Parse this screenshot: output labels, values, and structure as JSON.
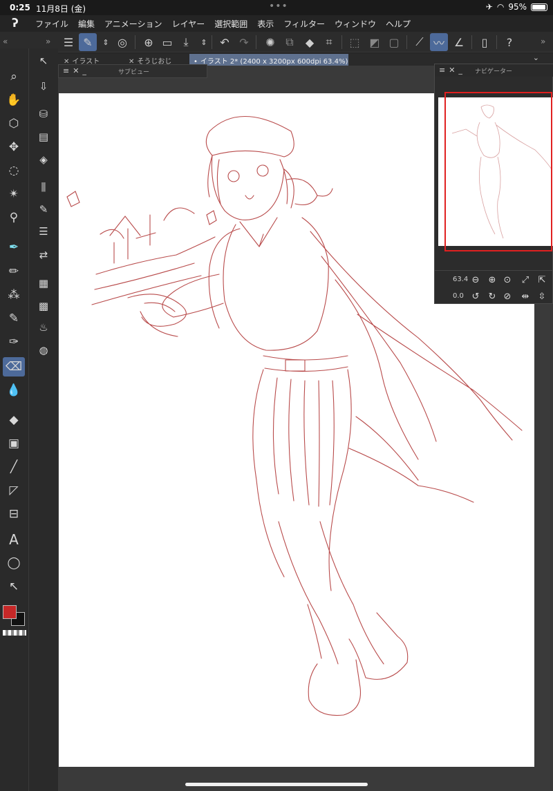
{
  "status": {
    "time": "0:25",
    "date": "11月8日 (金)",
    "battery": "95%"
  },
  "menu": {
    "items": [
      "ファイル",
      "編集",
      "アニメーション",
      "レイヤー",
      "選択範囲",
      "表示",
      "フィルター",
      "ウィンドウ",
      "ヘルプ"
    ]
  },
  "command_bar": {
    "icons": [
      "menu-icon",
      "edit-mode-icon",
      "up-down-icon",
      "spiral-logo-icon",
      "new-canvas-icon",
      "open-folder-icon",
      "save-icon",
      "up-down-icon",
      "undo-icon",
      "redo-icon",
      "loading-icon",
      "copy-icon",
      "fill-icon",
      "crop-icon",
      "deselect-icon",
      "invert-icon",
      "select-all-icon",
      "ruler-icon",
      "brush-icon",
      "line-icon",
      "smartphone-icon",
      "help-icon"
    ]
  },
  "tabs": [
    {
      "label": "イラスト",
      "active": false
    },
    {
      "label": "そうじおじ",
      "active": false
    },
    {
      "label": "イラスト 2* (2400 x 3200px 600dpi 63.4%)",
      "active": true
    }
  ],
  "subview": {
    "title": "サブビュー"
  },
  "navigator": {
    "title": "ナビゲーター",
    "zoom": "63.4",
    "rotation": "0.0"
  },
  "tools": {
    "items": [
      "zoom-icon",
      "hand-icon",
      "object-icon",
      "move-icon",
      "lasso-select-icon",
      "magic-wand-icon",
      "eyedropper-icon",
      "pen-icon",
      "pencil-icon",
      "airbrush-icon",
      "brush-icon",
      "decoration-icon",
      "eraser-icon",
      "blend-icon",
      "fill-icon",
      "gradient-icon",
      "line-icon",
      "ruler-icon",
      "frame-icon",
      "text-icon",
      "balloon-icon",
      "correct-line-icon"
    ]
  },
  "colors": {
    "main": "#c62828",
    "sub": "#111111",
    "accent": "#4d6a9a",
    "sketch_line": "#b84a4a"
  }
}
